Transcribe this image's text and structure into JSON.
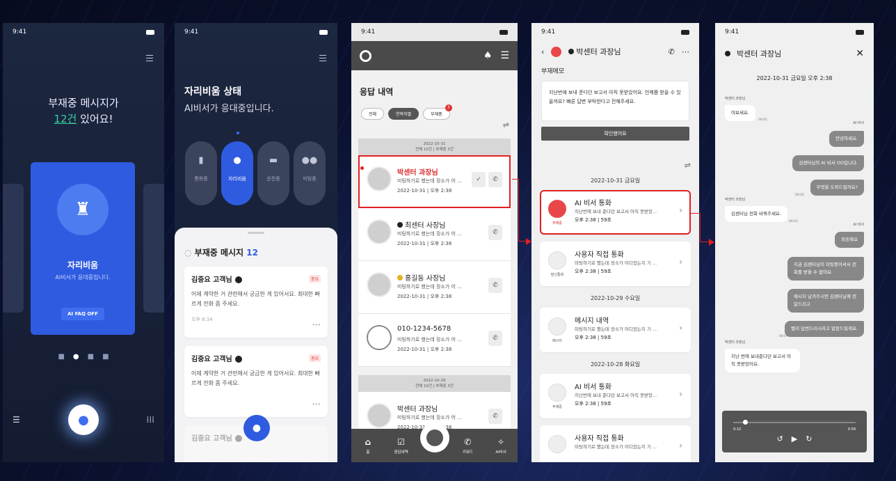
{
  "status_time": "9:41",
  "phone1": {
    "headline_line1": "부재중 메시지가",
    "count": "12건",
    "headline_suffix": "있어요!",
    "card_title": "자리비움",
    "card_subtitle": "AI비서가 응대중입니다.",
    "faq_button": "AI FAQ OFF",
    "accent_color": "#35d2a0"
  },
  "phone2": {
    "title": "자리비움 상태",
    "subtitle": "AI비서가 응대중입니다.",
    "modes": [
      "통화중",
      "자리비움",
      "운전중",
      "미팅중"
    ],
    "sheet_title": "부재중 메시지",
    "sheet_count": "12",
    "messages": [
      {
        "name": "김중요 고객님",
        "tag": "중요",
        "body": "어제 계약한 거 관련해서 궁금한 게 있어서요. 최대한 빠르게 전화 좀 주세요.",
        "time": "오후 6:34"
      },
      {
        "name": "김중요 고객님",
        "tag": "중요",
        "body": "어제 계약한 거 관련해서 궁금한 게 있어서요. 최대한 빠르게 전화 좀 주세요.",
        "time": ""
      },
      {
        "name": "김중요 고객님",
        "tag": "",
        "body": "",
        "time": ""
      }
    ]
  },
  "phone3": {
    "title": "응답 내역",
    "filters": [
      "전체",
      "연락처별",
      "부재중"
    ],
    "filter_badge": "3",
    "date_header1": "2022-10-31",
    "date_header1_sub": "전체 10건 | 부재중 3건",
    "date_header2": "2022-10-29",
    "date_header2_sub": "전체 10건 | 부재중 3건",
    "calls": [
      {
        "name": "박센터 과장님",
        "desc": "미팅하기로 했는데 장소가 어 ...",
        "date": "2022-10-31 | 오후 2:38"
      },
      {
        "name": "최센터 사장님",
        "desc": "미팅하기로 했는데 장소가 어 ...",
        "date": "2022-10-31 | 오후 2:38"
      },
      {
        "name": "홍길동 사장님",
        "desc": "미팅하기로 했는데 장소가 어 ...",
        "date": "2022-10-31 | 오후 2:38"
      },
      {
        "name": "010-1234-5678",
        "desc": "미팅하기로 했는데 장소가 어 ...",
        "date": "2022-10-31 | 오후 2:38"
      },
      {
        "name": "박센터 과장님",
        "desc": "미팅하기로 했는데 장소가 어 ...",
        "date": "2022-10-31 | 오후 2:38"
      }
    ],
    "tabs": [
      "홈",
      "응답내역",
      "",
      "키워드",
      "AI비서"
    ]
  },
  "phone4": {
    "contact": "박센터 과장님",
    "memo_label": "부재메모",
    "memo_text": "지난번에 보내 준다던 보고서 아직 못받았어요. 언제쯤 받을 수 있을까요? 빠른 답변 부탁한다고 전해주세요.",
    "confirm_button": "확인했어요",
    "groups": [
      {
        "date": "2022-10-31 금요일",
        "items": [
          {
            "title": "AI 비서 통화",
            "sub": "지난번에 보내 준다던 보고서 아직 못받았...",
            "meta": "오후 2:38 | 59초",
            "icon_label": "부재중"
          },
          {
            "title": "사용자 직접 통화",
            "sub": "미팅하기로 했는데 장소가 어디었는지 기 ...",
            "meta": "오후 2:38 | 59초",
            "icon_label": "발신통화"
          }
        ]
      },
      {
        "date": "2022-10-29 수요일",
        "items": [
          {
            "title": "메시지 내역",
            "sub": "미팅하기로 했는데 장소가 어디었는지 기 ...",
            "meta": "오후 2:38 | 59초",
            "icon_label": "메시지"
          }
        ]
      },
      {
        "date": "2022-10-28 화요일",
        "items": [
          {
            "title": "AI 비서 통화",
            "sub": "지난번에 보내 준다던 보고서 아직 못받았...",
            "meta": "오후 2:38 | 59초",
            "icon_label": "부재중"
          },
          {
            "title": "사용자 직접 통화",
            "sub": "미팅하기로 했는데 장소가 어디었는지 기 ...",
            "meta": "",
            "icon_label": ""
          }
        ]
      }
    ]
  },
  "phone5": {
    "contact": "박센터 과장님",
    "datetime": "2022-10-31 금요일 오후 2:38",
    "caller_label": "박센터 과장님",
    "ai_label": "AI 비서",
    "bubbles": [
      "여보세요.",
      "안녕하세요.",
      "김센터님의 AI 비서 OO입니다.",
      "무엇을 도와드릴까요?",
      "김센터님 전화 바꿔주세요.",
      "죄송해요",
      "지금 김센터님이 미팅중이셔서 전화를 받을 수 없어요.",
      "메시지 남겨주시면 김센터님께 전달드리고",
      "빨리 답변드리시라고 말씀드릴게요.",
      "지난 번에 보내준다던 보고서 아직 못받았어요."
    ],
    "times": [
      "00:01",
      "00:02",
      "00:03",
      "00:05",
      "00:07",
      "00:09"
    ],
    "player_start": "0:10",
    "player_end": "0:58"
  }
}
